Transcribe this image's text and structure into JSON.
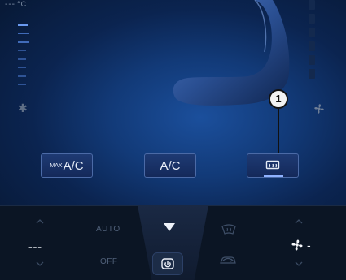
{
  "climate": {
    "left_temp_top": "---",
    "temp_unit": "°C",
    "callout_number": "1",
    "buttons": {
      "max_small": "MAX",
      "max_big": "A/C",
      "ac": "A/C"
    },
    "bottom": {
      "auto_label": "AUTO",
      "off_label": "OFF",
      "left_temp": "---",
      "fan_level": "-"
    }
  },
  "icons": [
    "snowflake-icon",
    "fan-icon",
    "seat-icon",
    "rear-defrost-icon",
    "windshield-defrost-icon",
    "recirculation-icon",
    "power-icon",
    "chevron-up-icon",
    "chevron-down-icon",
    "arrow-down-icon"
  ],
  "colors": {
    "accent": "#1b4f9c",
    "button_border": "#4b6aa6",
    "text_light": "#eef2fa",
    "text_dim": "#4f5f78"
  }
}
